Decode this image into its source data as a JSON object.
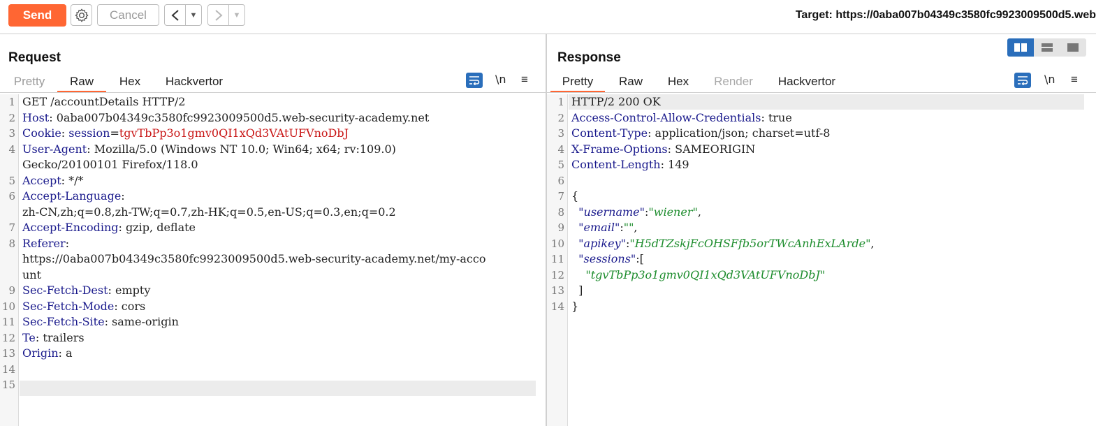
{
  "toolbar": {
    "send_label": "Send",
    "cancel_label": "Cancel",
    "target_text": "Target: https://0aba007b04349c3580fc9923009500d5.web"
  },
  "request": {
    "title": "Request",
    "tabs": [
      "Pretty",
      "Raw",
      "Hex",
      "Hackvertor"
    ],
    "active_tab": "Raw",
    "newline_label": "\\n",
    "menu_label": "≡",
    "lines": [
      {
        "n": "1",
        "parts": [
          [
            "v",
            "GET /accountDetails HTTP/2"
          ]
        ]
      },
      {
        "n": "2",
        "parts": [
          [
            "k",
            "Host"
          ],
          [
            "v",
            ": 0aba007b04349c3580fc9923009500d5.web-security-academy.net"
          ]
        ]
      },
      {
        "n": "3",
        "parts": [
          [
            "k",
            "Cookie"
          ],
          [
            "v",
            ": "
          ],
          [
            "k",
            "session"
          ],
          [
            "v",
            "="
          ],
          [
            "red",
            "tgvTbPp3o1gmv0QI1xQd3VAtUFVnoDbJ"
          ]
        ]
      },
      {
        "n": "4",
        "parts": [
          [
            "k",
            "User-Agent"
          ],
          [
            "v",
            ": Mozilla/5.0 (Windows NT 10.0; Win64; x64; rv:109.0)"
          ]
        ]
      },
      {
        "n": "",
        "parts": [
          [
            "v",
            "Gecko/20100101 Firefox/118.0"
          ]
        ]
      },
      {
        "n": "5",
        "parts": [
          [
            "k",
            "Accept"
          ],
          [
            "v",
            ": */*"
          ]
        ]
      },
      {
        "n": "6",
        "parts": [
          [
            "k",
            "Accept-Language"
          ],
          [
            "v",
            ":"
          ]
        ]
      },
      {
        "n": "",
        "parts": [
          [
            "v",
            "zh-CN,zh;q=0.8,zh-TW;q=0.7,zh-HK;q=0.5,en-US;q=0.3,en;q=0.2"
          ]
        ]
      },
      {
        "n": "7",
        "parts": [
          [
            "k",
            "Accept-Encoding"
          ],
          [
            "v",
            ": gzip, deflate"
          ]
        ]
      },
      {
        "n": "8",
        "parts": [
          [
            "k",
            "Referer"
          ],
          [
            "v",
            ":"
          ]
        ]
      },
      {
        "n": "",
        "parts": [
          [
            "v",
            "https://0aba007b04349c3580fc9923009500d5.web-security-academy.net/my-acco"
          ]
        ]
      },
      {
        "n": "",
        "parts": [
          [
            "v",
            "unt"
          ]
        ]
      },
      {
        "n": "9",
        "parts": [
          [
            "k",
            "Sec-Fetch-Dest"
          ],
          [
            "v",
            ": empty"
          ]
        ]
      },
      {
        "n": "10",
        "parts": [
          [
            "k",
            "Sec-Fetch-Mode"
          ],
          [
            "v",
            ": cors"
          ]
        ]
      },
      {
        "n": "11",
        "parts": [
          [
            "k",
            "Sec-Fetch-Site"
          ],
          [
            "v",
            ": same-origin"
          ]
        ]
      },
      {
        "n": "12",
        "parts": [
          [
            "k",
            "Te"
          ],
          [
            "v",
            ": trailers"
          ]
        ]
      },
      {
        "n": "13",
        "parts": [
          [
            "k",
            "Origin"
          ],
          [
            "v",
            ": a"
          ]
        ]
      },
      {
        "n": "14",
        "parts": []
      },
      {
        "n": "15",
        "parts": []
      }
    ]
  },
  "response": {
    "title": "Response",
    "tabs": [
      "Pretty",
      "Raw",
      "Hex",
      "Render",
      "Hackvertor"
    ],
    "active_tab": "Pretty",
    "newline_label": "\\n",
    "menu_label": "≡",
    "lines": [
      {
        "n": "1",
        "parts": [
          [
            "v",
            "HTTP/2 200 OK"
          ]
        ]
      },
      {
        "n": "2",
        "parts": [
          [
            "k",
            "Access-Control-Allow-Credentials"
          ],
          [
            "v",
            ": true"
          ]
        ]
      },
      {
        "n": "3",
        "parts": [
          [
            "k",
            "Content-Type"
          ],
          [
            "v",
            ": application/json; charset=utf-8"
          ]
        ]
      },
      {
        "n": "4",
        "parts": [
          [
            "k",
            "X-Frame-Options"
          ],
          [
            "v",
            ": SAMEORIGIN"
          ]
        ]
      },
      {
        "n": "5",
        "parts": [
          [
            "k",
            "Content-Length"
          ],
          [
            "v",
            ": 149"
          ]
        ]
      },
      {
        "n": "6",
        "parts": []
      },
      {
        "n": "7",
        "parts": [
          [
            "v",
            "{"
          ]
        ]
      },
      {
        "n": "8",
        "parts": [
          [
            "v",
            "  "
          ],
          [
            "j",
            "\"username\""
          ],
          [
            "v",
            ":"
          ],
          [
            "s",
            "\"wiener\""
          ],
          [
            "v",
            ","
          ]
        ]
      },
      {
        "n": "9",
        "parts": [
          [
            "v",
            "  "
          ],
          [
            "j",
            "\"email\""
          ],
          [
            "v",
            ":"
          ],
          [
            "s",
            "\"\""
          ],
          [
            "v",
            ","
          ]
        ]
      },
      {
        "n": "10",
        "parts": [
          [
            "v",
            "  "
          ],
          [
            "j",
            "\"apikey\""
          ],
          [
            "v",
            ":"
          ],
          [
            "s",
            "\"H5dTZskjFcOHSFfb5orTWcAnhExLArde\""
          ],
          [
            "v",
            ","
          ]
        ]
      },
      {
        "n": "11",
        "parts": [
          [
            "v",
            "  "
          ],
          [
            "j",
            "\"sessions\""
          ],
          [
            "v",
            ":["
          ]
        ]
      },
      {
        "n": "12",
        "parts": [
          [
            "v",
            "    "
          ],
          [
            "s",
            "\"tgvTbPp3o1gmv0QI1xQd3VAtUFVnoDbJ\""
          ]
        ]
      },
      {
        "n": "13",
        "parts": [
          [
            "v",
            "  ]"
          ]
        ]
      },
      {
        "n": "14",
        "parts": [
          [
            "v",
            "}"
          ]
        ]
      }
    ]
  },
  "colors": {
    "accent": "#ff6633",
    "header_name": "#1a1a8c",
    "cookie_value": "#c81414",
    "json_string": "#1c8c2c",
    "tool_blue": "#2a6ebb"
  }
}
